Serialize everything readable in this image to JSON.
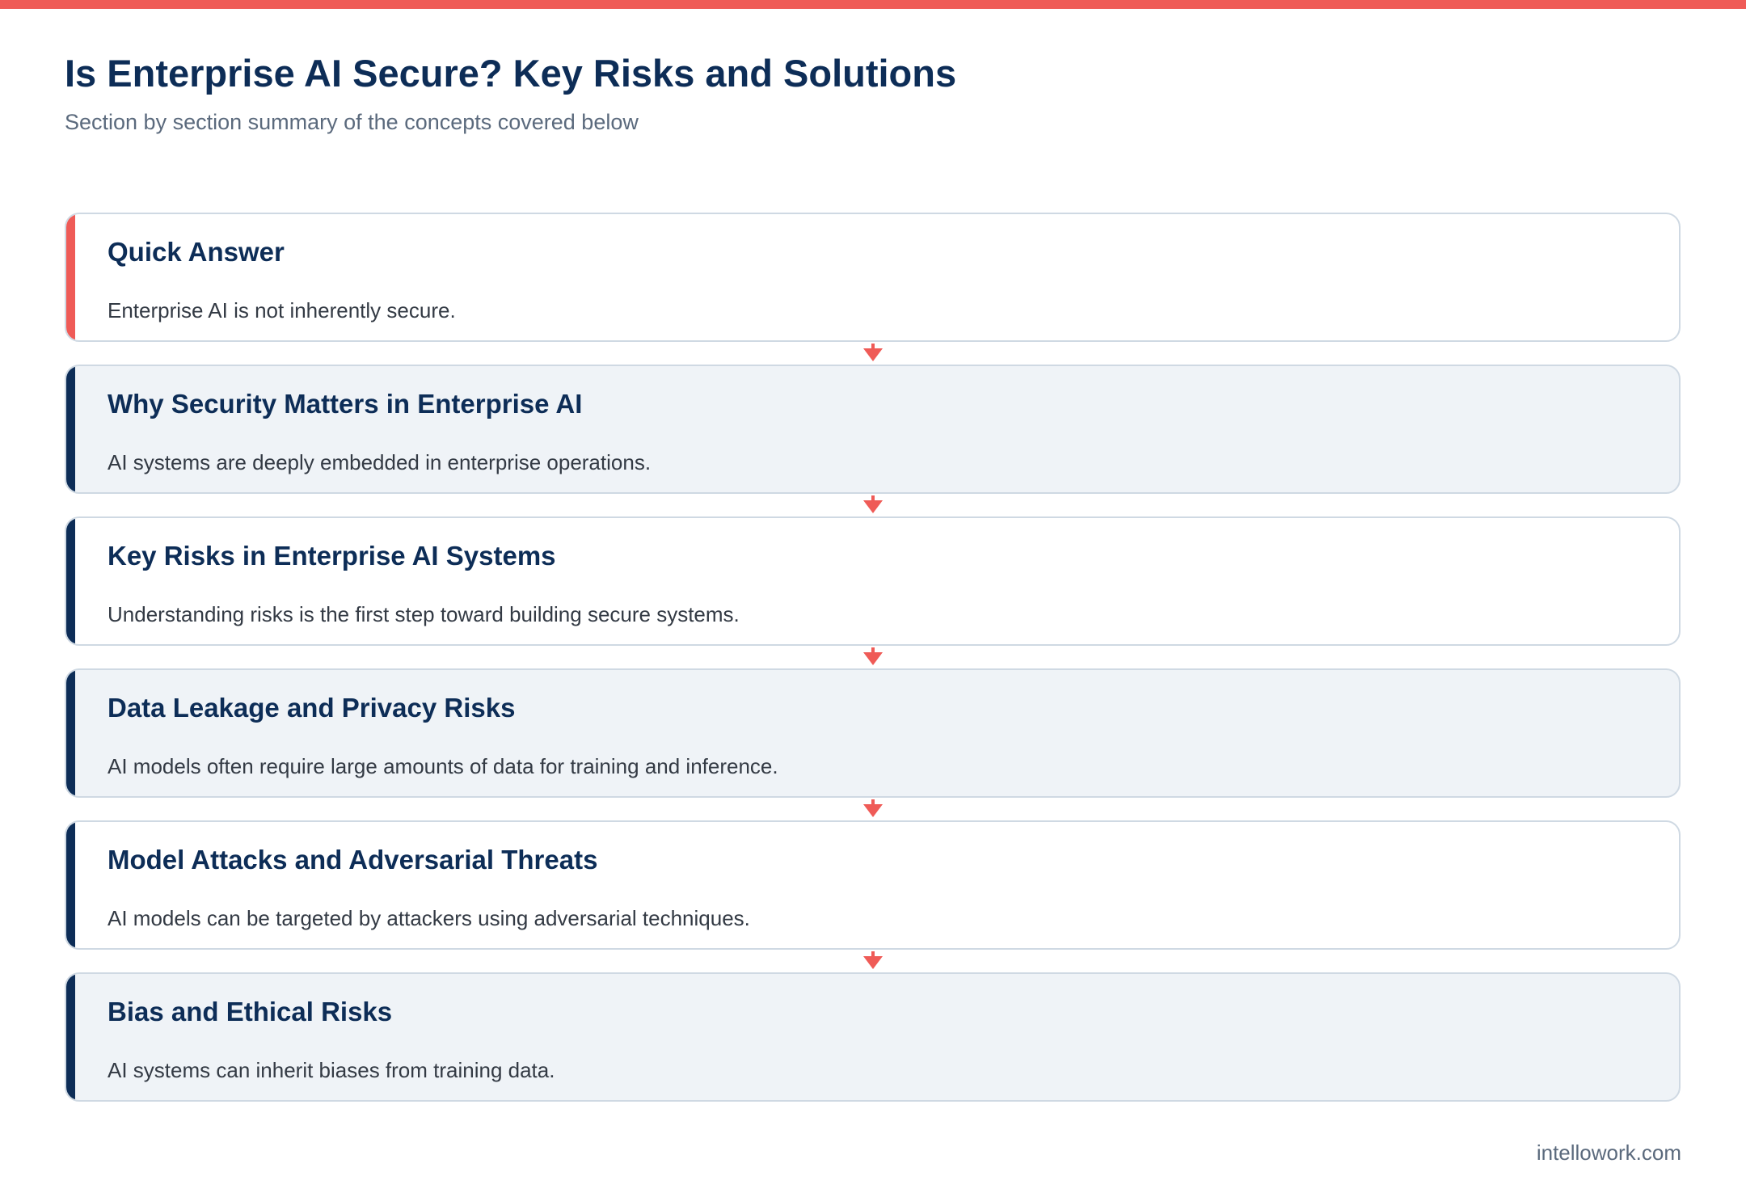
{
  "header": {
    "title": "Is Enterprise AI Secure? Key Risks and Solutions",
    "subtitle": "Section by section summary of the concepts covered below"
  },
  "sections": [
    {
      "title": "Quick Answer",
      "text": "Enterprise AI is not inherently secure."
    },
    {
      "title": "Why Security Matters in Enterprise AI",
      "text": "AI systems are deeply embedded in enterprise operations."
    },
    {
      "title": "Key Risks in Enterprise AI Systems",
      "text": "Understanding risks is the first step toward building secure systems."
    },
    {
      "title": "Data Leakage and Privacy Risks",
      "text": "AI models often require large amounts of data for training and inference."
    },
    {
      "title": "Model Attacks and Adversarial Threats",
      "text": "AI models can be targeted by attackers using adversarial techniques."
    },
    {
      "title": "Bias and Ethical Risks",
      "text": "AI systems can inherit biases from training data."
    }
  ],
  "footer": {
    "domain": "intellowork.com"
  },
  "colors": {
    "accent": "#ef5b57",
    "navy": "#0d2d57",
    "card_alt_bg": "#eff3f7",
    "border": "#cfd9e3"
  },
  "icons": {
    "connector": "arrow-down-icon"
  }
}
